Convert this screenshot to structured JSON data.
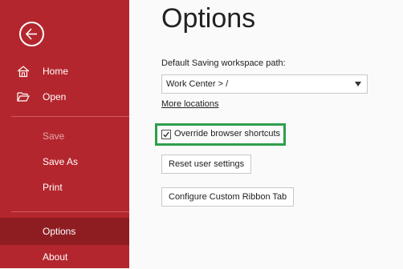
{
  "sidebar": {
    "items": [
      {
        "label": "Home",
        "icon": "home-icon",
        "state": "normal"
      },
      {
        "label": "Open",
        "icon": "folder-open-icon",
        "state": "normal"
      },
      {
        "label": "Save",
        "state": "disabled"
      },
      {
        "label": "Save As",
        "state": "normal"
      },
      {
        "label": "Print",
        "state": "normal"
      },
      {
        "label": "Options",
        "state": "active"
      },
      {
        "label": "About",
        "state": "normal"
      }
    ],
    "back_icon": "back-arrow-icon",
    "colors": {
      "background": "#b4262d",
      "active": "#8e1d22"
    }
  },
  "main": {
    "title": "Options",
    "workspace_label": "Default Saving workspace path:",
    "workspace_value": "Work Center > /",
    "more_locations": "More locations",
    "override_checkbox": {
      "label": "Override browser shortcuts",
      "checked": true
    },
    "reset_button": "Reset user settings",
    "ribbon_button": "Configure Custom Ribbon Tab",
    "highlight_color": "#2e9e4b"
  }
}
